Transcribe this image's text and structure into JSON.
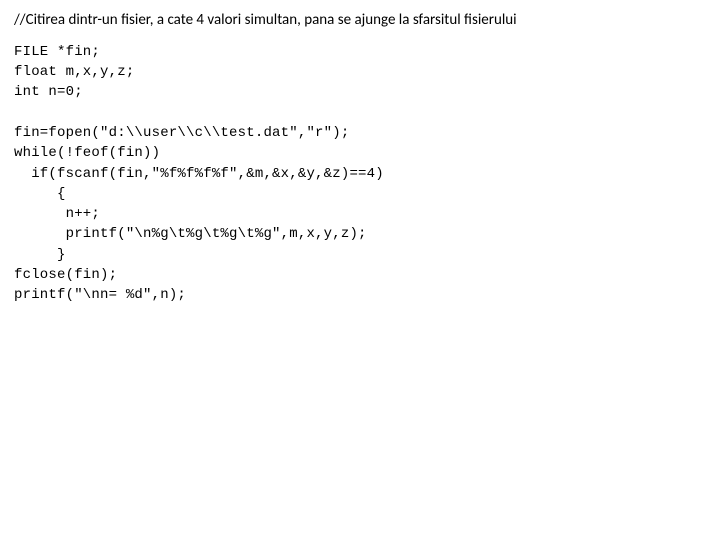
{
  "comment": "//Citirea dintr-un fisier, a cate 4 valori simultan, pana se ajunge la sfarsitul fisierului",
  "code": "FILE *fin;\nfloat m,x,y,z;\nint n=0;\n\nfin=fopen(\"d:\\\\user\\\\c\\\\test.dat\",\"r\");\nwhile(!feof(fin))\n  if(fscanf(fin,\"%f%f%f%f\",&m,&x,&y,&z)==4)\n     {\n      n++;\n      printf(\"\\n%g\\t%g\\t%g\\t%g\",m,x,y,z);\n     }\nfclose(fin);\nprintf(\"\\nn= %d\",n);"
}
